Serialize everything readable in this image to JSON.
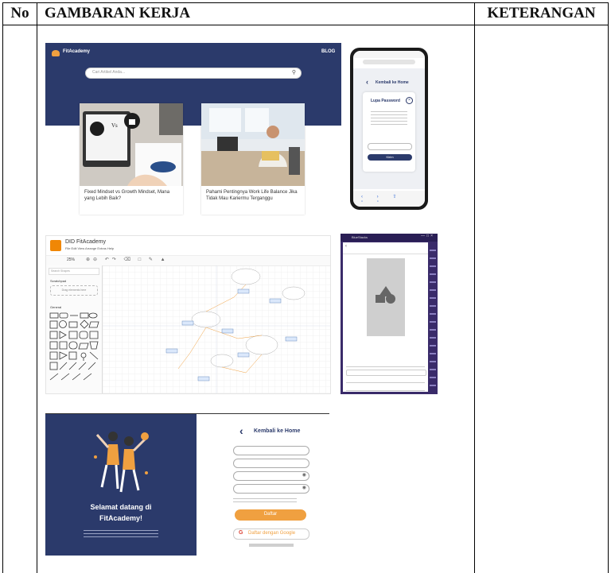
{
  "table": {
    "col_no": "No",
    "col_gambaran": "GAMBARAN KERJA",
    "col_keterangan": "KETERANGAN"
  },
  "web_home": {
    "brand": "FitAcademy",
    "nav_blog": "BLOG",
    "search_placeholder": "Cari Artikel Anda...",
    "card1_text": "Fixed Mindset vs Growth Mindset, Mana yang Lebih Baik?",
    "card2_text": "Pahami Pentingnya Work Life Balance Jika Tidak Mau Kariermu Terganggu"
  },
  "phone_forgot": {
    "back_label": "Kembali ke Home",
    "modal_title": "Lupa Password",
    "submit_label": "Kirim"
  },
  "drawio": {
    "title": "DID FitAcademy",
    "menu": "File  Edit  View  Arrange  Extras  Help",
    "zoom": "25%",
    "search_placeholder": "Search Shapes",
    "section_scratchpad": "Scratchpad",
    "drop_hint": "Drag elements here",
    "section_general": "General"
  },
  "android_emulator": {
    "window_title": "BlueStacks"
  },
  "register": {
    "welcome_line1": "Selamat datang di",
    "welcome_line2": "FitAcademy!",
    "back_label": "Kembali ke Home",
    "submit_label": "Daftar",
    "google_label": "Daftar dengan Google"
  },
  "colors": {
    "navy": "#2b3a6b",
    "orange": "#f0a040",
    "drawio_orange": "#f08705"
  }
}
